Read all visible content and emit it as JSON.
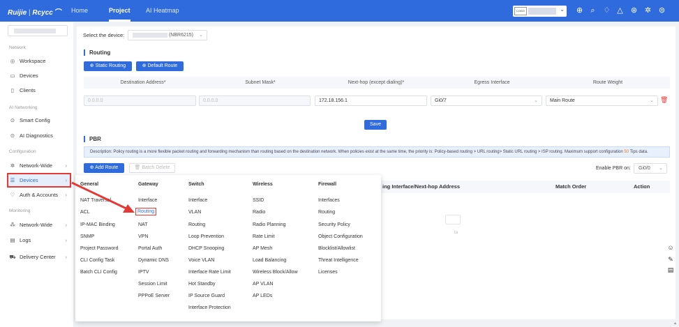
{
  "brand": {
    "logo": "Ruijie",
    "sep": " | ",
    "name": "Rcycc"
  },
  "top_nav": [
    {
      "label": "Home"
    },
    {
      "label": "Project"
    },
    {
      "label": "AI Heatmap"
    }
  ],
  "account": {
    "logo_text": "LOGO"
  },
  "top_icons": [
    "add-circle-icon",
    "search-icon",
    "bell-icon",
    "alert-icon",
    "globe-icon",
    "gear-icon",
    "user-icon"
  ],
  "sidebar": {
    "sections": [
      {
        "title": "Network",
        "items": [
          {
            "label": "Workspace",
            "icon": "workspace-icon"
          },
          {
            "label": "Devices",
            "icon": "devices-icon"
          },
          {
            "label": "Clients",
            "icon": "clients-icon"
          }
        ]
      },
      {
        "title": "AI Networking",
        "items": [
          {
            "label": "Smart Config",
            "icon": "smart-config-icon"
          },
          {
            "label": "AI Diagnostics",
            "icon": "ai-diagnostics-icon"
          }
        ]
      },
      {
        "title": "Configuration",
        "items": [
          {
            "label": "Network-Wide",
            "icon": "network-wide-icon",
            "chevron": true
          },
          {
            "label": "Devices",
            "icon": "devices-config-icon",
            "chevron": true,
            "selected": true
          },
          {
            "label": "Auth & Accounts",
            "icon": "auth-icon",
            "chevron": true
          }
        ]
      },
      {
        "title": "Monitoring",
        "items": [
          {
            "label": "Network-Wide",
            "icon": "monitor-network-icon",
            "chevron": true
          },
          {
            "label": "Logs",
            "icon": "logs-icon",
            "chevron": true
          },
          {
            "label": "Delivery Center",
            "icon": "delivery-icon",
            "chevron": true
          }
        ]
      }
    ]
  },
  "device_select": {
    "label": "Select the device:",
    "value": "(NBR6215)"
  },
  "routing": {
    "title": "Routing",
    "buttons": {
      "static": "Static Routing",
      "default": "Default Route"
    },
    "columns": [
      "Destination Address*",
      "Subnet Mask*",
      "Next-hop (except dialing)*",
      "Egress Interface",
      "Route Weight"
    ],
    "row": {
      "dest": "0.0.0.0",
      "mask": "0.0.0.0",
      "nexthop": "172.18.156.1",
      "egress": "Gi0/7",
      "weight": "Main Route"
    },
    "save": "Save"
  },
  "pbr": {
    "title": "PBR",
    "description_pre": "Description: Policy routing is a more flexible packet routing and forwarding mechanism than routing based on the destination network. When policies exist at the same time, the priority is: Policy-based routing > URL routing> Static URL routing > ISP routing. Maximum support configuration ",
    "description_num": "50",
    "description_post": " Tips data.",
    "add_btn": "Add Route",
    "batch_delete": "Batch Delete",
    "enable_label": "Enable PBR on:",
    "enable_value": "Gi0/0",
    "columns_visible": [
      "ing Interface/Next-hop Address",
      "Match Order",
      "Action"
    ],
    "nodata_fragment": "ta"
  },
  "mega_menu": {
    "columns": [
      {
        "head": "General",
        "items": [
          "NAT Traversal",
          "ACL",
          "IP-MAC Binding",
          "SNMP",
          "Project Password",
          "CLI Config Task",
          "Batch CLI Config"
        ]
      },
      {
        "head": "Gateway",
        "items": [
          "Interface",
          "Routing",
          "NAT",
          "VPN",
          "Portal Auth",
          "Dynamic DNS",
          "IPTV",
          "Session Limit",
          "PPPoE Server"
        ],
        "highlight": "Routing"
      },
      {
        "head": "Switch",
        "items": [
          "Interface",
          "VLAN",
          "Routing",
          "Loop Prevention",
          "DHCP Snooping",
          "Voice VLAN",
          "Interface Rate Limit",
          "Hot Standby",
          "IP Source Guard",
          "Interface Protection"
        ]
      },
      {
        "head": "Wireless",
        "items": [
          "SSID",
          "Radio",
          "Radio Planning",
          "Rate Limit",
          "AP Mesh",
          "Load Balancing",
          "Wireless Block/Allow",
          "AP VLAN",
          "AP LEDs"
        ]
      },
      {
        "head": "Firewall",
        "items": [
          "Interfaces",
          "Routing",
          "Security Policy",
          "Object Configuration",
          "Blocklist/Allowlist",
          "Threat Intelligence",
          "Licenses"
        ]
      }
    ]
  },
  "float_icons": [
    "chat-icon",
    "feedback-icon",
    "clipboard-icon"
  ]
}
